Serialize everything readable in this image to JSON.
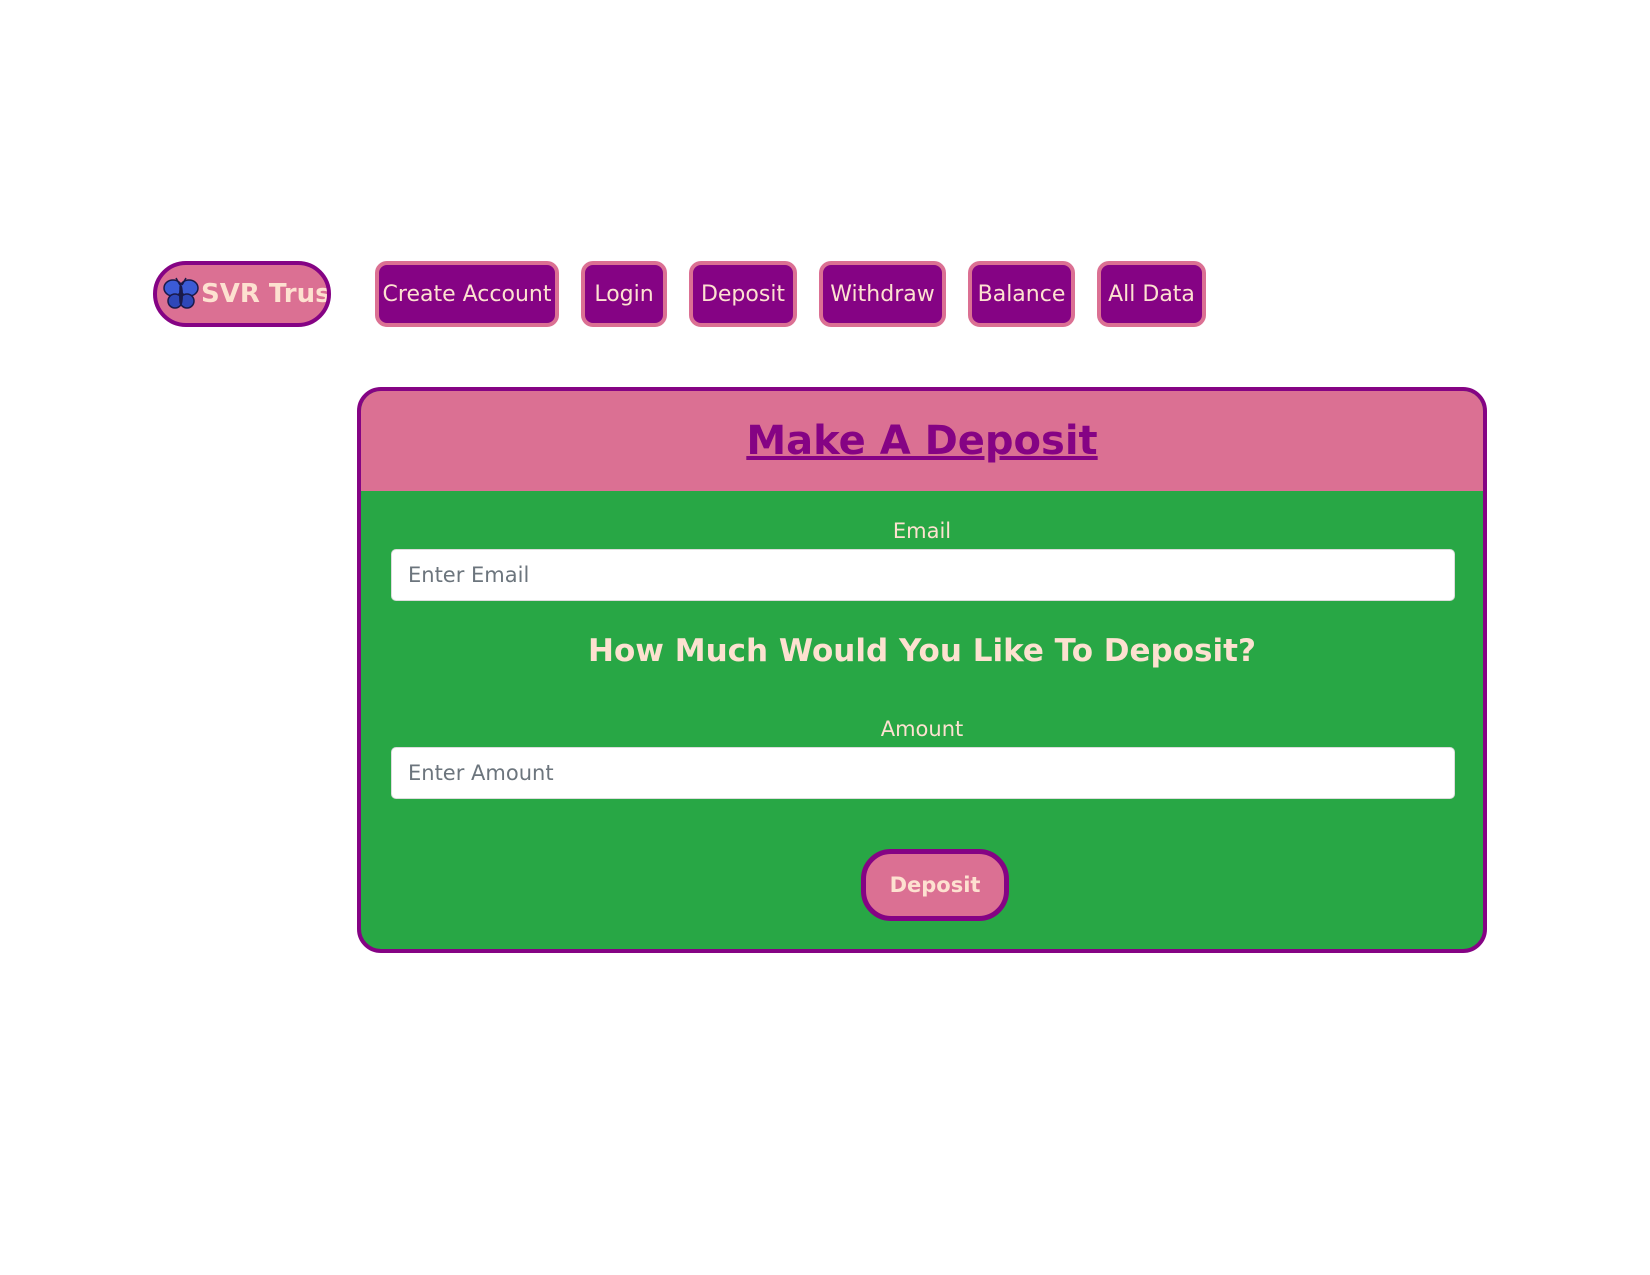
{
  "brand": {
    "name": "SVR Trust",
    "icon": "butterfly-icon"
  },
  "nav": {
    "items": [
      {
        "label": "Create Account"
      },
      {
        "label": "Login"
      },
      {
        "label": "Deposit"
      },
      {
        "label": "Withdraw"
      },
      {
        "label": "Balance"
      },
      {
        "label": "All Data"
      }
    ]
  },
  "card": {
    "title": "Make A Deposit",
    "email_label": "Email",
    "email_placeholder": "Enter Email",
    "email_value": "",
    "question": "How Much Would You Like To Deposit?",
    "amount_label": "Amount",
    "amount_placeholder": "Enter Amount",
    "amount_value": "",
    "submit_label": "Deposit"
  },
  "colors": {
    "purple": "#850384",
    "pink": "#db7093",
    "green": "#28a745",
    "cream": "#fde1d0",
    "page_background": "#ffffff"
  }
}
